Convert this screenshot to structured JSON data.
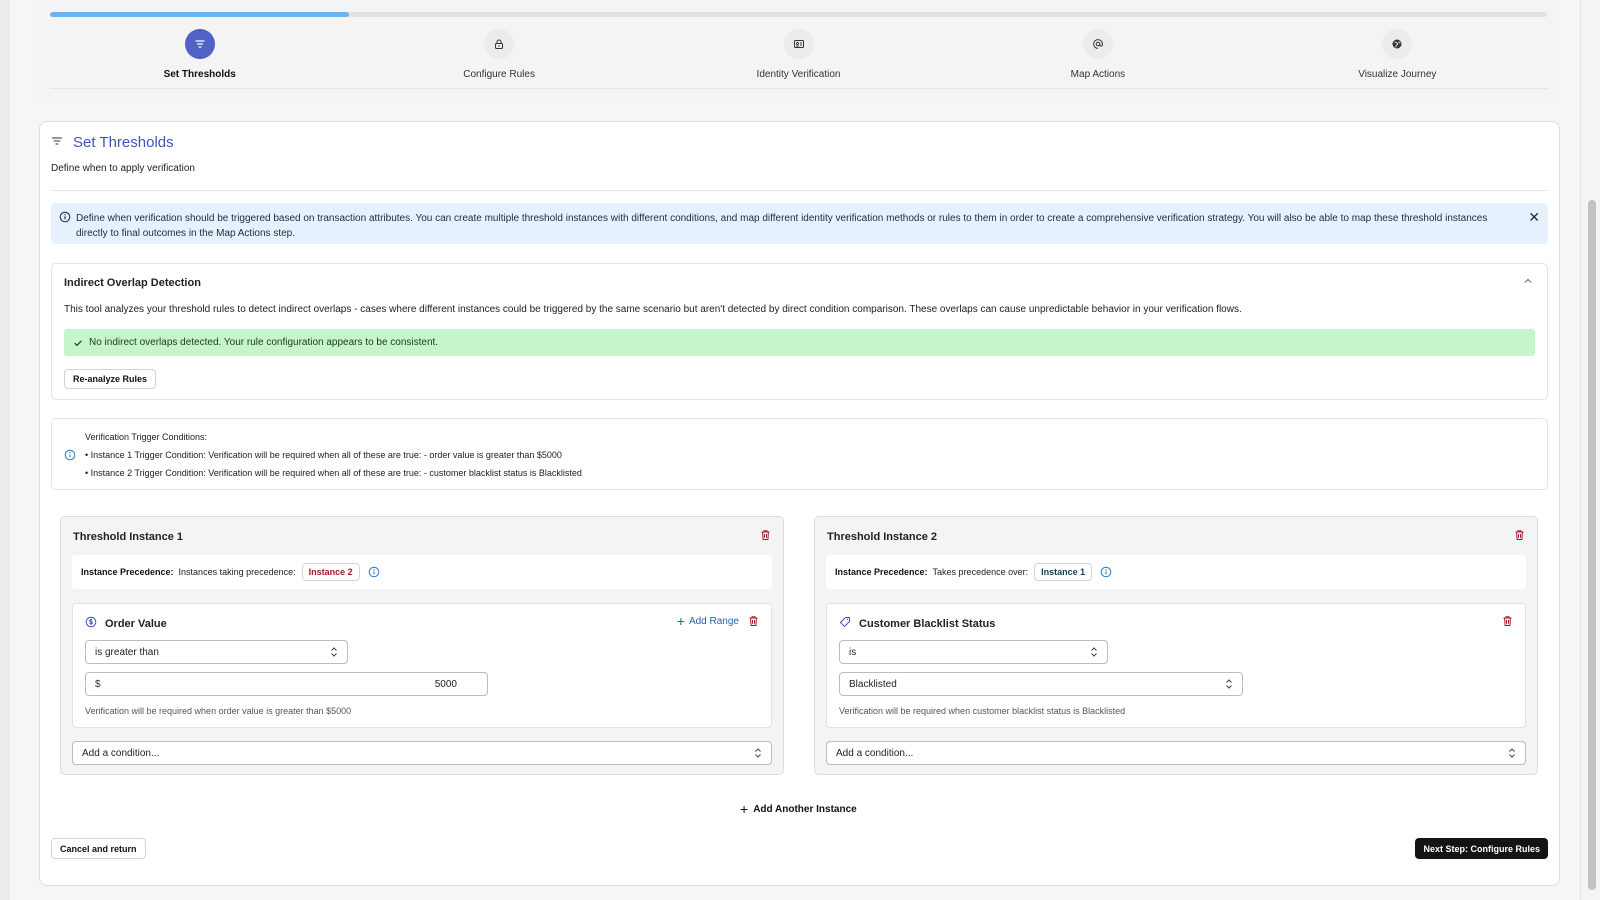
{
  "progress": {
    "fraction": 0.2
  },
  "steps": [
    {
      "label": "Set Thresholds",
      "icon": "filter-icon",
      "active": true
    },
    {
      "label": "Configure Rules",
      "icon": "lock-icon",
      "active": false
    },
    {
      "label": "Identity Verification",
      "icon": "id-card-icon",
      "active": false
    },
    {
      "label": "Map Actions",
      "icon": "at-sign-icon",
      "active": false
    },
    {
      "label": "Visualize Journey",
      "icon": "globe-icon",
      "active": false
    }
  ],
  "card": {
    "title": "Set Thresholds",
    "subtitle": "Define when to apply verification"
  },
  "info_banner": {
    "text": "Define when verification should be triggered based on transaction attributes. You can create multiple threshold instances with different conditions, and map different identity verification methods or rules to them in order to create a comprehensive verification strategy. You will also be able to map these threshold instances directly to final outcomes in the Map Actions step.",
    "close": "✕"
  },
  "overlap": {
    "title": "Indirect Overlap Detection",
    "description": "This tool analyzes your threshold rules to detect indirect overlaps - cases where different instances could be triggered by the same scenario but aren't detected by direct condition comparison. These overlaps can cause unpredictable behavior in your verification flows.",
    "success": "No indirect overlaps detected. Your rule configuration appears to be consistent.",
    "reanalyze": "Re-analyze Rules"
  },
  "trigger": {
    "title": "Verification Trigger Conditions:",
    "lines": [
      "• Instance 1 Trigger Condition: Verification will be required when all of these are true: - order value is greater than $5000",
      "• Instance 2 Trigger Condition: Verification will be required when all of these are true: - customer blacklist status is Blacklisted"
    ]
  },
  "instances": [
    {
      "title": "Threshold Instance 1",
      "precedence_label": "Instance Precedence:",
      "precedence_text": "Instances taking precedence:",
      "precedence_badge": "Instance 2",
      "condition": {
        "name": "Order Value",
        "icon": "dollar-circle-icon",
        "add_range": "Add Range",
        "operator": "is greater than",
        "currency": "$",
        "value": "5000",
        "helper": "Verification will be required when order value is greater than $5000"
      },
      "add_condition": "Add a condition..."
    },
    {
      "title": "Threshold Instance 2",
      "precedence_label": "Instance Precedence:",
      "precedence_text": "Takes precedence over:",
      "precedence_badge": "Instance 1",
      "condition": {
        "name": "Customer Blacklist Status",
        "icon": "tag-icon",
        "operator": "is",
        "value": "Blacklisted",
        "helper": "Verification will be required when customer blacklist status is Blacklisted"
      },
      "add_condition": "Add a condition..."
    }
  ],
  "footer": {
    "add_instance": "Add Another Instance",
    "cancel": "Cancel and return",
    "next": "Next Step: Configure Rules"
  },
  "colors": {
    "accent": "#5261c4",
    "progress": "#6fb3ec",
    "success_bg": "#c5f5c9",
    "info_bg": "#e5f1fc",
    "danger": "#a11a2b",
    "link": "#2563a8"
  }
}
